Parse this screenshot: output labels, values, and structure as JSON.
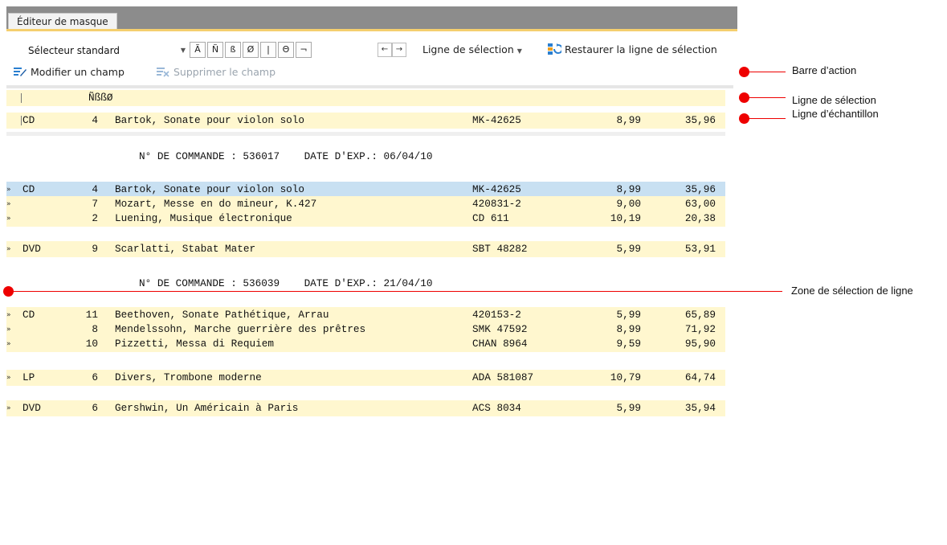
{
  "tab": {
    "title": "Éditeur de masque"
  },
  "toolbar": {
    "selector_value": "Sélecteur standard",
    "char_buttons": [
      "Ã",
      "Ñ",
      "ß",
      "Ø",
      "|",
      "Θ",
      "¬"
    ],
    "arrow_left": "←",
    "arrow_right": "→",
    "selection_line_label": "Ligne de sélection",
    "restore_label": "Restaurer la ligne de sélection",
    "modify_field_label": "Modifier un champ",
    "delete_field_label": "Supprimer le champ"
  },
  "selection_line": {
    "text": "ÑßßØ"
  },
  "sample_line": {
    "type": "CD",
    "qty": "4",
    "title": "Bartok, Sonate pour violon solo",
    "ref": "MK-42625",
    "price": "8,99",
    "total": "35,96"
  },
  "orders": [
    {
      "header": "N° DE COMMANDE : 536017    DATE D'EXP.: 06/04/10"
    },
    {
      "header": "N° DE COMMANDE : 536039    DATE D'EXP.: 21/04/10"
    }
  ],
  "rows": [
    {
      "marker": "»",
      "type": "CD",
      "qty": "4",
      "title": "Bartok, Sonate pour violon solo",
      "ref": "MK-42625",
      "price": "8,99",
      "total": "35,96"
    },
    {
      "marker": "»",
      "type": "",
      "qty": "7",
      "title": "Mozart, Messe en do mineur, K.427",
      "ref": "420831-2",
      "price": "9,00",
      "total": "63,00"
    },
    {
      "marker": "»",
      "type": "",
      "qty": "2",
      "title": "Luening, Musique électronique",
      "ref": "CD 611",
      "price": "10,19",
      "total": "20,38"
    },
    {
      "marker": "»",
      "type": "DVD",
      "qty": "9",
      "title": "Scarlatti, Stabat Mater",
      "ref": "SBT 48282",
      "price": "5,99",
      "total": "53,91"
    },
    {
      "marker": "»",
      "type": "CD",
      "qty": "11",
      "title": "Beethoven, Sonate Pathétique, Arrau",
      "ref": "420153-2",
      "price": "5,99",
      "total": "65,89"
    },
    {
      "marker": "»",
      "type": "",
      "qty": "8",
      "title": "Mendelssohn, Marche guerrière des prêtres",
      "ref": "SMK 47592",
      "price": "8,99",
      "total": "71,92"
    },
    {
      "marker": "»",
      "type": "",
      "qty": "10",
      "title": "Pizzetti, Messa di Requiem",
      "ref": "CHAN 8964",
      "price": "9,59",
      "total": "95,90"
    },
    {
      "marker": "»",
      "type": "LP",
      "qty": "6",
      "title": "Divers, Trombone moderne",
      "ref": "ADA 581087",
      "price": "10,79",
      "total": "64,74"
    },
    {
      "marker": "»",
      "type": "DVD",
      "qty": "6",
      "title": "Gershwin, Un Américain à Paris",
      "ref": "ACS 8034",
      "price": "5,99",
      "total": "35,94"
    }
  ],
  "callouts": {
    "action_bar": "Barre d’action",
    "selection_line": "Ligne de sélection",
    "sample_line": "Ligne d’échantillon",
    "line_selection_zone": "Zone de sélection de ligne"
  },
  "colors": {
    "callout": "#ee0000",
    "row_yellow": "#fff7cf",
    "row_selected": "#c8e0f2",
    "tab_accent": "#f5cf6e"
  }
}
